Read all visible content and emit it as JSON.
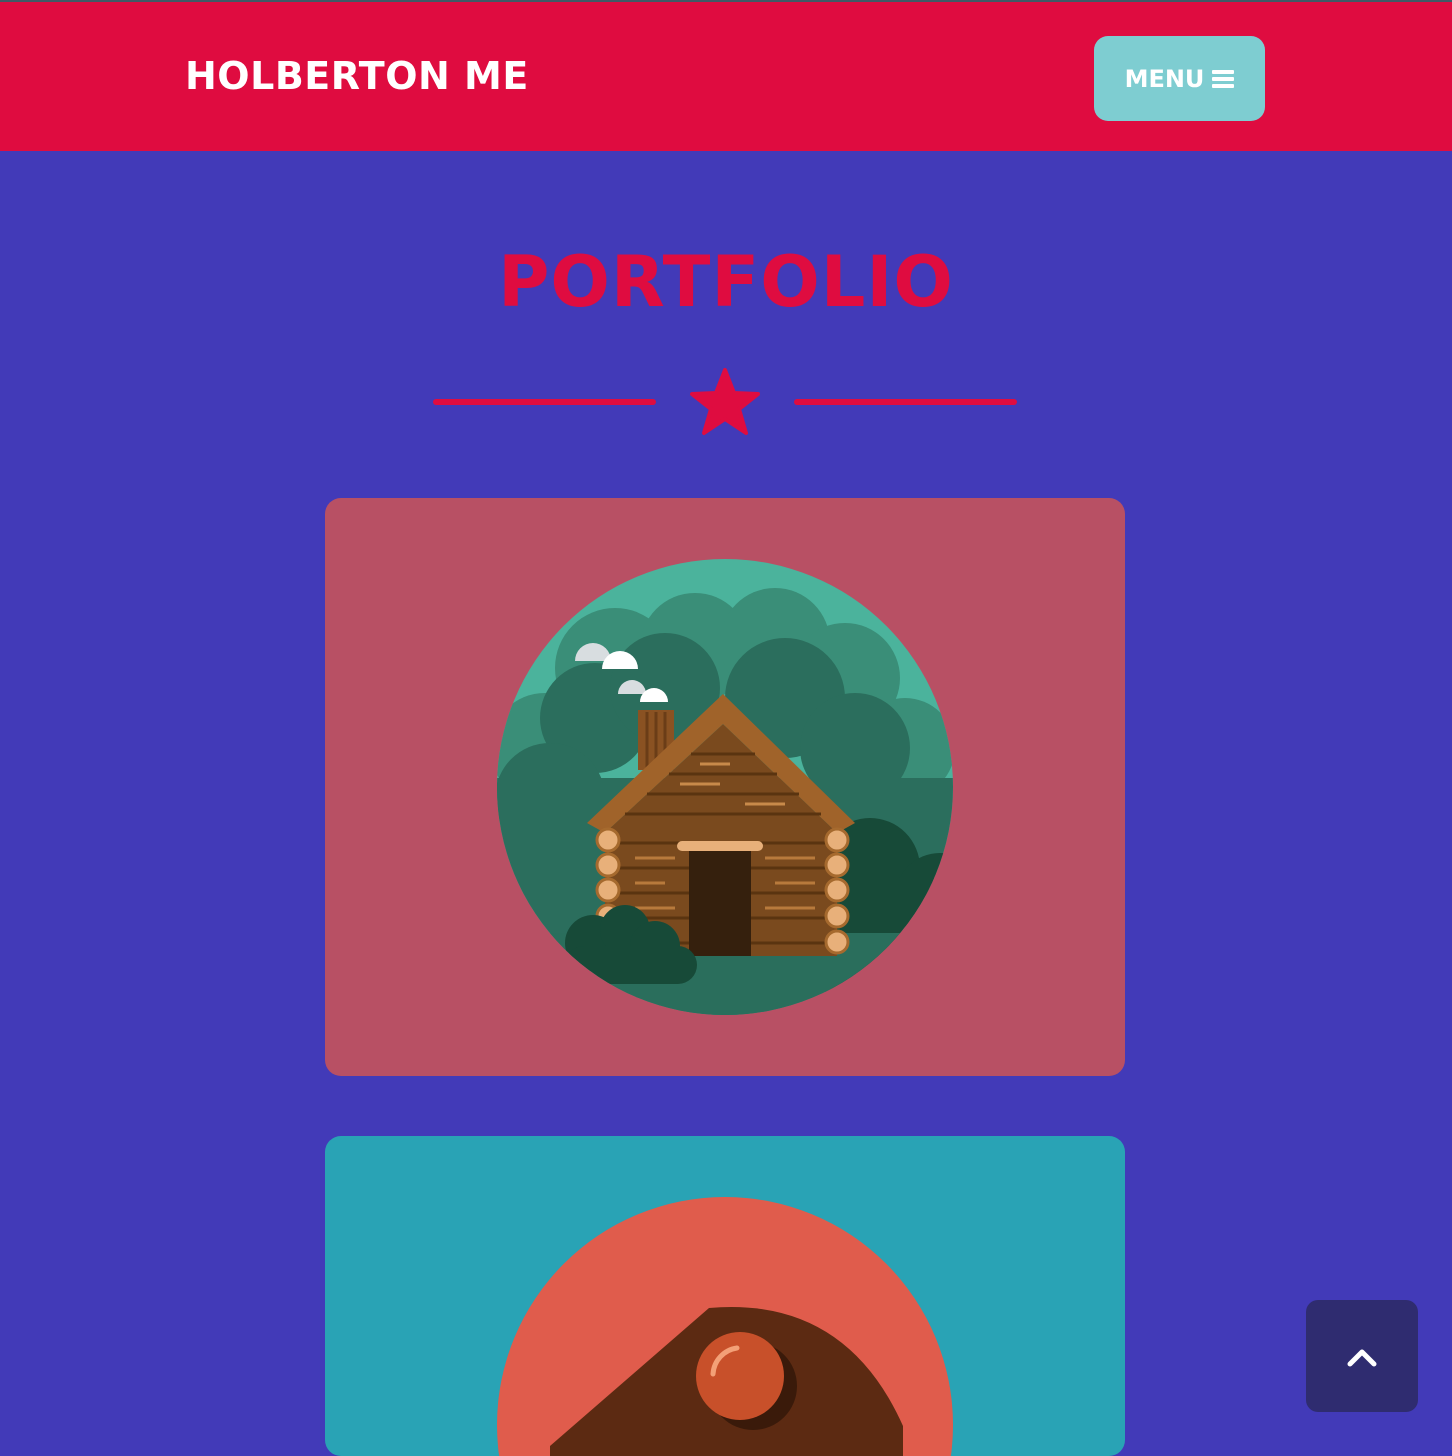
{
  "header": {
    "brand": "HOLBERTON ME",
    "menu_label": "MENU",
    "menu_icon": "bars-icon"
  },
  "portfolio": {
    "title": "PORTFOLIO",
    "divider_icon": "star-icon",
    "items": [
      {
        "name": "cabin",
        "background": "#b85064"
      },
      {
        "name": "cake",
        "background": "#29a3b5"
      }
    ]
  },
  "scroll_top": {
    "icon": "chevron-up-icon"
  },
  "colors": {
    "navbar": "#df0c40",
    "page_background": "#423ab8",
    "accent": "#df0c40",
    "menu_button": "#7ecdd1",
    "scroll_top_button": "#2f2c70"
  }
}
